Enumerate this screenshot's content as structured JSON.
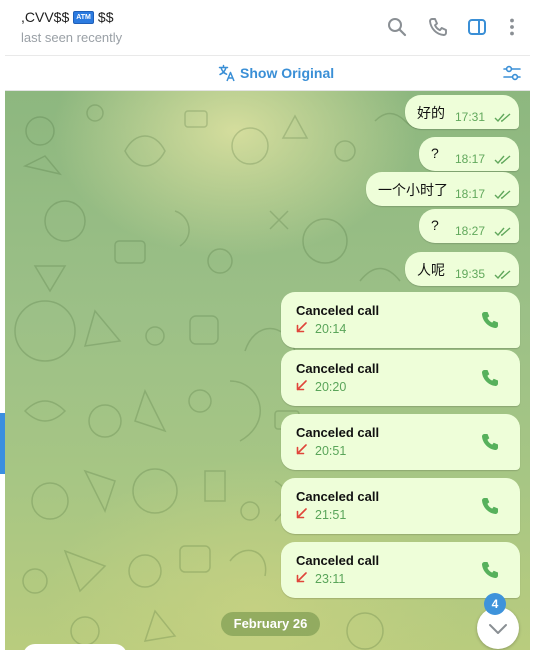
{
  "header": {
    "title_prefix": ",CVV$$",
    "title_badge": "ATM",
    "title_suffix": "$$",
    "status": "last seen recently",
    "icons": [
      "search-icon",
      "phone-icon",
      "sidebar-toggle-icon",
      "more-vertical-icon"
    ]
  },
  "translate_bar": {
    "label": "Show Original",
    "icon": "translate-icon",
    "settings_icon": "settings-sliders-icon"
  },
  "messages": [
    {
      "text": "好的",
      "time": "17:31"
    },
    {
      "text": "?",
      "time": "18:17"
    },
    {
      "text": "一个小时了",
      "time": "18:17"
    },
    {
      "text": "?",
      "time": "18:27"
    },
    {
      "text": "人呢",
      "time": "19:35"
    }
  ],
  "calls": [
    {
      "title": "Canceled call",
      "time": "20:14"
    },
    {
      "title": "Canceled call",
      "time": "20:20"
    },
    {
      "title": "Canceled call",
      "time": "20:51"
    },
    {
      "title": "Canceled call",
      "time": "21:51"
    },
    {
      "title": "Canceled call",
      "time": "23:11"
    }
  ],
  "date_separator": "February 26",
  "unread_badge": "4",
  "colors": {
    "accent": "#3a8fd6",
    "bubble": "#eefed9",
    "time": "#61a85c",
    "missed_arrow": "#e0453a",
    "call_icon": "#57b15c"
  }
}
